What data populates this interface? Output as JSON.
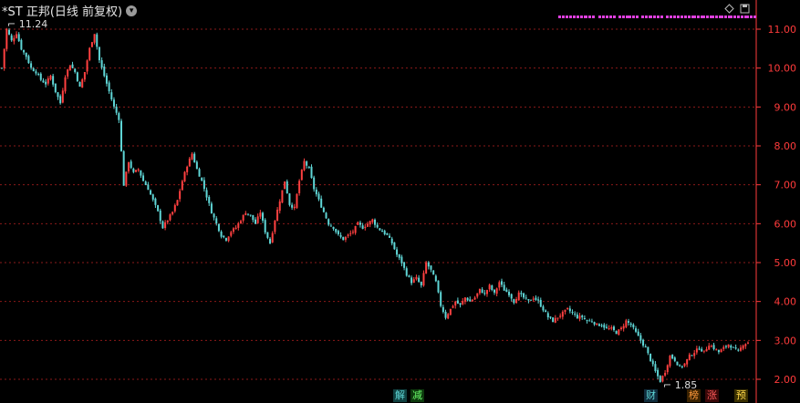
{
  "header": {
    "title": "*ST 正邦(日线 前复权)",
    "dropdown_icon": "chevron-down-icon"
  },
  "window_controls": [
    "diamond-icon",
    "restore-icon"
  ],
  "colors": {
    "background": "#000000",
    "grid": "#8b1a1a",
    "axis": "#ff3b3b",
    "up": "#ff4040",
    "down": "#5fd6d6",
    "signal": "#e040e0"
  },
  "annotations": {
    "high": "11.24",
    "low": "1.85"
  },
  "badges": [
    {
      "label": "解",
      "color": "#5fd6d6",
      "bg": "#104040"
    },
    {
      "label": "减",
      "color": "#6cff6c",
      "bg": "#0d3a0d"
    },
    {
      "label": "财",
      "color": "#5fd6d6",
      "bg": "#102c3c"
    },
    {
      "label": "榜",
      "color": "#ff9a3c",
      "bg": "#3a2200"
    },
    {
      "label": "涨",
      "color": "#ff5a5a",
      "bg": "#3a0808"
    },
    {
      "label": "预",
      "color": "#ffd84a",
      "bg": "#3a3000"
    }
  ],
  "chart_data": {
    "type": "candlestick",
    "ylim": [
      1.7,
      11.5
    ],
    "yticks": [
      "2.00",
      "3.00",
      "4.00",
      "5.00",
      "6.00",
      "7.00",
      "8.00",
      "9.00",
      "10.00",
      "11.00"
    ],
    "close_points": [
      [
        0,
        10.0
      ],
      [
        2,
        11.0
      ],
      [
        4,
        10.7
      ],
      [
        6,
        10.9
      ],
      [
        8,
        10.5
      ],
      [
        10,
        10.3
      ],
      [
        12,
        10.0
      ],
      [
        14,
        9.9
      ],
      [
        16,
        9.7
      ],
      [
        18,
        9.6
      ],
      [
        20,
        9.8
      ],
      [
        22,
        9.4
      ],
      [
        24,
        9.1
      ],
      [
        26,
        9.8
      ],
      [
        28,
        10.1
      ],
      [
        30,
        9.9
      ],
      [
        32,
        9.5
      ],
      [
        34,
        9.9
      ],
      [
        36,
        10.5
      ],
      [
        38,
        10.9
      ],
      [
        40,
        10.2
      ],
      [
        42,
        9.8
      ],
      [
        44,
        9.4
      ],
      [
        46,
        9.0
      ],
      [
        48,
        8.7
      ],
      [
        50,
        7.0
      ],
      [
        52,
        7.6
      ],
      [
        54,
        7.3
      ],
      [
        56,
        7.4
      ],
      [
        58,
        7.1
      ],
      [
        60,
        6.9
      ],
      [
        62,
        6.6
      ],
      [
        64,
        6.3
      ],
      [
        66,
        5.9
      ],
      [
        68,
        6.1
      ],
      [
        70,
        6.3
      ],
      [
        72,
        6.6
      ],
      [
        74,
        7.1
      ],
      [
        76,
        7.5
      ],
      [
        78,
        7.8
      ],
      [
        80,
        7.4
      ],
      [
        82,
        7.1
      ],
      [
        84,
        6.7
      ],
      [
        86,
        6.3
      ],
      [
        88,
        6.0
      ],
      [
        90,
        5.7
      ],
      [
        92,
        5.6
      ],
      [
        94,
        5.8
      ],
      [
        96,
        5.9
      ],
      [
        98,
        6.1
      ],
      [
        100,
        6.3
      ],
      [
        102,
        6.2
      ],
      [
        104,
        6.0
      ],
      [
        106,
        6.3
      ],
      [
        108,
        5.8
      ],
      [
        110,
        5.5
      ],
      [
        112,
        6.1
      ],
      [
        114,
        6.6
      ],
      [
        116,
        7.1
      ],
      [
        118,
        6.5
      ],
      [
        120,
        6.4
      ],
      [
        122,
        7.1
      ],
      [
        124,
        7.6
      ],
      [
        126,
        7.4
      ],
      [
        128,
        6.9
      ],
      [
        130,
        6.6
      ],
      [
        132,
        6.3
      ],
      [
        134,
        6.0
      ],
      [
        136,
        5.9
      ],
      [
        138,
        5.7
      ],
      [
        140,
        5.6
      ],
      [
        142,
        5.7
      ],
      [
        144,
        5.8
      ],
      [
        146,
        6.0
      ],
      [
        148,
        5.9
      ],
      [
        150,
        6.0
      ],
      [
        152,
        6.1
      ],
      [
        154,
        5.9
      ],
      [
        156,
        5.8
      ],
      [
        158,
        5.7
      ],
      [
        160,
        5.5
      ],
      [
        162,
        5.2
      ],
      [
        164,
        5.0
      ],
      [
        166,
        4.7
      ],
      [
        168,
        4.5
      ],
      [
        170,
        4.6
      ],
      [
        172,
        4.4
      ],
      [
        174,
        5.0
      ],
      [
        176,
        4.8
      ],
      [
        178,
        4.5
      ],
      [
        180,
        3.9
      ],
      [
        182,
        3.6
      ],
      [
        184,
        3.8
      ],
      [
        186,
        4.0
      ],
      [
        188,
        3.9
      ],
      [
        190,
        4.1
      ],
      [
        192,
        4.0
      ],
      [
        194,
        4.1
      ],
      [
        196,
        4.3
      ],
      [
        198,
        4.2
      ],
      [
        200,
        4.4
      ],
      [
        202,
        4.2
      ],
      [
        204,
        4.5
      ],
      [
        206,
        4.3
      ],
      [
        208,
        4.2
      ],
      [
        210,
        4.0
      ],
      [
        212,
        4.2
      ],
      [
        214,
        4.1
      ],
      [
        216,
        4.0
      ],
      [
        218,
        4.1
      ],
      [
        220,
        4.0
      ],
      [
        224,
        3.6
      ],
      [
        226,
        3.5
      ],
      [
        228,
        3.6
      ],
      [
        230,
        3.7
      ],
      [
        232,
        3.8
      ],
      [
        234,
        3.7
      ],
      [
        236,
        3.6
      ],
      [
        238,
        3.6
      ],
      [
        240,
        3.5
      ],
      [
        242,
        3.5
      ],
      [
        244,
        3.4
      ],
      [
        246,
        3.4
      ],
      [
        248,
        3.3
      ],
      [
        250,
        3.3
      ],
      [
        252,
        3.2
      ],
      [
        254,
        3.3
      ],
      [
        256,
        3.5
      ],
      [
        258,
        3.4
      ],
      [
        260,
        3.2
      ],
      [
        262,
        3.0
      ],
      [
        264,
        2.8
      ],
      [
        266,
        2.5
      ],
      [
        268,
        2.2
      ],
      [
        270,
        1.95
      ],
      [
        272,
        2.2
      ],
      [
        274,
        2.6
      ],
      [
        276,
        2.5
      ],
      [
        278,
        2.3
      ],
      [
        280,
        2.4
      ],
      [
        282,
        2.6
      ],
      [
        284,
        2.7
      ],
      [
        286,
        2.8
      ],
      [
        288,
        2.7
      ],
      [
        290,
        2.9
      ],
      [
        292,
        2.8
      ],
      [
        294,
        2.7
      ],
      [
        296,
        2.8
      ],
      [
        298,
        2.9
      ],
      [
        300,
        2.8
      ],
      [
        302,
        2.7
      ],
      [
        304,
        2.9
      ],
      [
        306,
        2.95
      ]
    ]
  }
}
